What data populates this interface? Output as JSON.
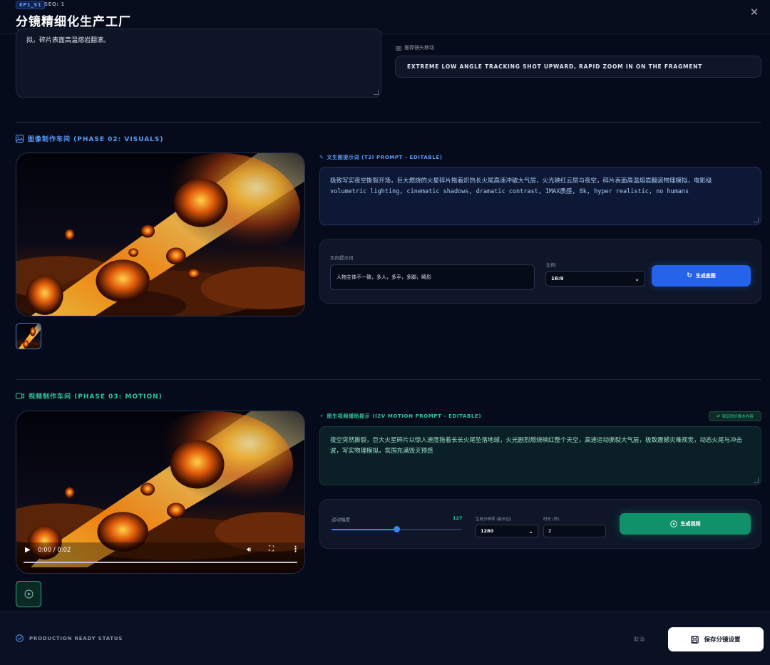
{
  "header": {
    "episode_badge": "EP1_S1",
    "seq": "SEQ: 1",
    "title": "分镜精细化生产工厂"
  },
  "story": {
    "visible_text": "拟，碎片表面高温熔岩翻滚。"
  },
  "camera": {
    "label": "推荐镜头移动",
    "value": "EXTREME LOW ANGLE TRACKING SHOT UPWARD, RAPID ZOOM IN ON THE FRAGMENT"
  },
  "visual": {
    "section_title": "图像制作车间 (PHASE 02: VISUALS)",
    "prompt_label": "文生图提示词 (T2I PROMPT - EDITABLE)",
    "prompt_text": "极致写实夜空撕裂开场，巨大燃烧的火星碎片拖着炽热长火尾高速冲破大气层，火光映红云层与夜空，碎片表面高温熔岩翻滚物理模拟，电影级 volumetric lighting, cinematic shadows, dramatic contrast, IMAX质感, 8k, hyper realistic, no humans",
    "negative_label": "负向提示词",
    "negative_value": "人物主体不一致，多人，多手，多脚，畸形",
    "ratio_label": "比例",
    "ratio_value": "16:9",
    "generate_label": "生成底图"
  },
  "motion": {
    "section_title": "视频制作车间 (PHASE 03: MOTION)",
    "prompt_label": "图生视频辅助提示 (I2V MOTION PROMPT - EDITABLE)",
    "sync_label": "锁定同步脚本内容",
    "prompt_text": "夜空突然撕裂，巨大火星碎片以惊人速度拖着长长火尾坠落地球，火光剧烈燃烧映红整个天空，高速运动撕裂大气层，极致震撼灾难视觉，动态火尾与冲击波，写实物理模拟，氛围充满毁灭预感",
    "intensity_label": "运动幅度",
    "intensity_value": "127",
    "intensity_fraction": 0.5,
    "resolution_label": "生成分辨率 (最长边)",
    "resolution_value": "1280",
    "duration_label": "时长 (秒)",
    "duration_value": "2",
    "generate_label": "生成视频",
    "video_time": "0:00 / 0:02"
  },
  "footer": {
    "status": "PRODUCTION READY STATUS",
    "cancel": "取消",
    "save": "保存分镜设置"
  },
  "colors": {
    "background": "#060b1b",
    "visual_accent": "#5b9cf7",
    "motion_accent": "#2fc49a",
    "primary_button": "#2563eb",
    "video_button": "#10916a"
  }
}
